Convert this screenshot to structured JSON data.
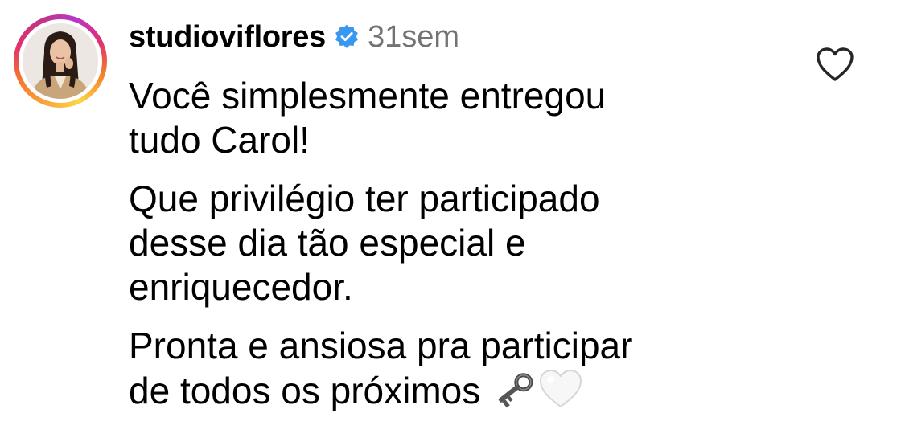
{
  "comment": {
    "username": "studioviflores",
    "verified": true,
    "timestamp": "31sem",
    "paragraphs": [
      "Você simplesmente entregou\ntudo Carol!",
      "Que privilégio ter participado\ndesse dia tão especial e\nenriquecedor.",
      "Pronta e ansiosa pra participar\nde todos os próximos"
    ],
    "trailing_emojis": [
      "old-key-emoji",
      "white-heart-emoji"
    ]
  },
  "icons": {
    "verified": "verified-badge-icon",
    "like": "heart-outline-icon"
  },
  "colors": {
    "verified_blue": "#3897f0",
    "timestamp_gray": "#737373",
    "icon_gray": "#262626"
  }
}
